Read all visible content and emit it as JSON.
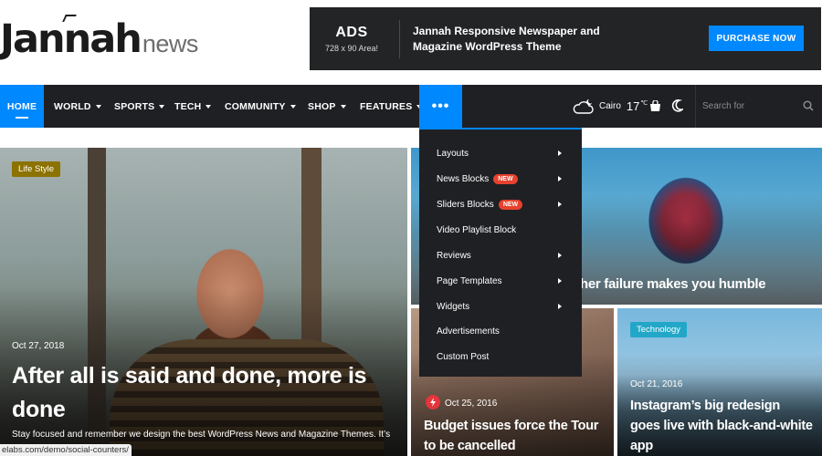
{
  "header": {
    "logo_main": "Jannah",
    "logo_sub": "news",
    "ad": {
      "title": "ADS",
      "size": "728 x 90 Area!",
      "text": "Jannah Responsive Newspaper and Magazine WordPress Theme",
      "button_label": "PURCHASE NOW"
    }
  },
  "nav": {
    "items": [
      {
        "label": "HOME"
      },
      {
        "label": "WORLD"
      },
      {
        "label": "SPORTS"
      },
      {
        "label": "TECH"
      },
      {
        "label": "COMMUNITY"
      },
      {
        "label": "SHOP"
      },
      {
        "label": "FEATURES"
      }
    ],
    "more_label": "•••",
    "weather": {
      "city": "Cairo",
      "temp": "17",
      "unit": "℃",
      "icon": "cloudy-night-icon"
    },
    "search_placeholder": "Search for"
  },
  "dropdown": {
    "items": [
      {
        "label": "Layouts",
        "badge": "",
        "has_submenu": true
      },
      {
        "label": "News Blocks",
        "badge": "NEW",
        "has_submenu": true
      },
      {
        "label": "Sliders Blocks",
        "badge": "NEW",
        "has_submenu": true
      },
      {
        "label": "Video Playlist Block",
        "badge": "",
        "has_submenu": false
      },
      {
        "label": "Reviews",
        "badge": "",
        "has_submenu": true
      },
      {
        "label": "Page Templates",
        "badge": "",
        "has_submenu": true
      },
      {
        "label": "Widgets",
        "badge": "",
        "has_submenu": true
      },
      {
        "label": "Advertisements",
        "badge": "",
        "has_submenu": false
      },
      {
        "label": "Custom Post",
        "badge": "",
        "has_submenu": false
      }
    ]
  },
  "posts": {
    "main": {
      "category": "Life Style",
      "date": "Oct 27, 2018",
      "title": "After all is said and done, more is done",
      "excerpt": "Stay focused and remember we design the best WordPress News and Magazine Themes. It’s"
    },
    "top_right": {
      "title": "her failure makes you humble"
    },
    "bottom_mid": {
      "date": "Oct 25, 2016",
      "title": "Budget issues force the Tour to be cancelled"
    },
    "bottom_right": {
      "category": "Technology",
      "date": "Oct 21, 2016",
      "title": "Instagram’s big redesign goes live with black-and-white app"
    }
  },
  "status_bar_url": "elabs.com/demo/social-counters/",
  "colors": {
    "accent": "#0088ff",
    "nav_bg": "#1f2024",
    "new_badge": "#e6422e",
    "life_style": "#8c7200",
    "technology": "#22a7c8"
  }
}
